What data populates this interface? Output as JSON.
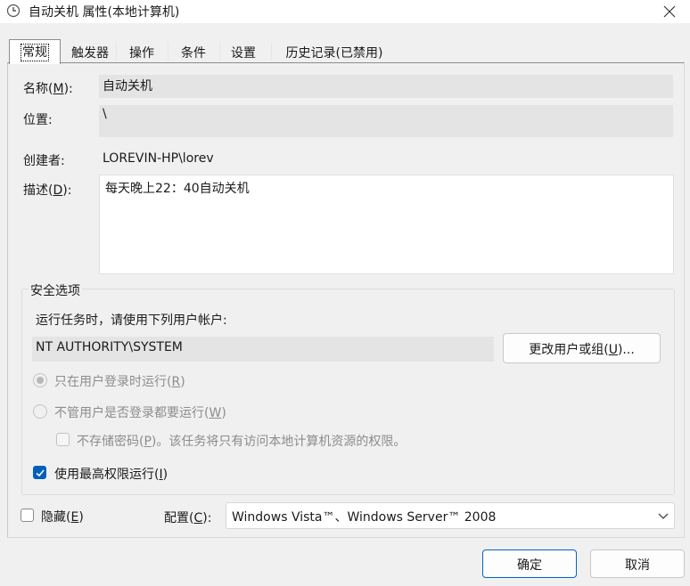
{
  "window": {
    "title": "自动关机 属性(本地计算机)",
    "icon": "clock-icon",
    "close_icon": "close-icon"
  },
  "tabs": [
    {
      "label": "常规",
      "active": true
    },
    {
      "label": "触发器"
    },
    {
      "label": "操作"
    },
    {
      "label": "条件"
    },
    {
      "label": "设置"
    },
    {
      "label": "历史记录(已禁用)"
    }
  ],
  "general": {
    "name_label_pre": "名称(",
    "name_label_key": "M",
    "name_label_post": "):",
    "name_value": "自动关机",
    "location_label": "位置:",
    "location_value": "\\",
    "author_label": "创建者:",
    "author_value": "LOREVIN-HP\\lorev",
    "desc_label_pre": "描述(",
    "desc_label_key": "D",
    "desc_label_post": "):",
    "desc_value": "每天晚上22：40自动关机"
  },
  "security": {
    "group_title": "安全选项",
    "run_as_label": "运行任务时，请使用下列用户帐户:",
    "account_value": "NT AUTHORITY\\SYSTEM",
    "change_button_pre": "更改用户或组(",
    "change_button_key": "U",
    "change_button_post": ")...",
    "radio_logged_on_pre": "只在用户登录时运行(",
    "radio_logged_on_key": "R",
    "radio_logged_on_post": ")",
    "radio_whether_pre": "不管用户是否登录都要运行(",
    "radio_whether_key": "W",
    "radio_whether_post": ")",
    "no_store_pre": "不存储密码(",
    "no_store_key": "P",
    "no_store_post": ")。该任务将只有访问本地计算机资源的权限。",
    "highest_pre": "使用最高权限运行(",
    "highest_key": "I",
    "highest_post": ")",
    "highest_checked": true
  },
  "bottom": {
    "hidden_pre": "隐藏(",
    "hidden_key": "E",
    "hidden_post": ")",
    "config_pre": "配置(",
    "config_key": "C",
    "config_post": "):",
    "config_value": "Windows Vista™、Windows Server™ 2008"
  },
  "buttons": {
    "ok": "确定",
    "cancel": "取消"
  },
  "colors": {
    "accent": "#005fb8",
    "background": "#f0f0f0"
  }
}
